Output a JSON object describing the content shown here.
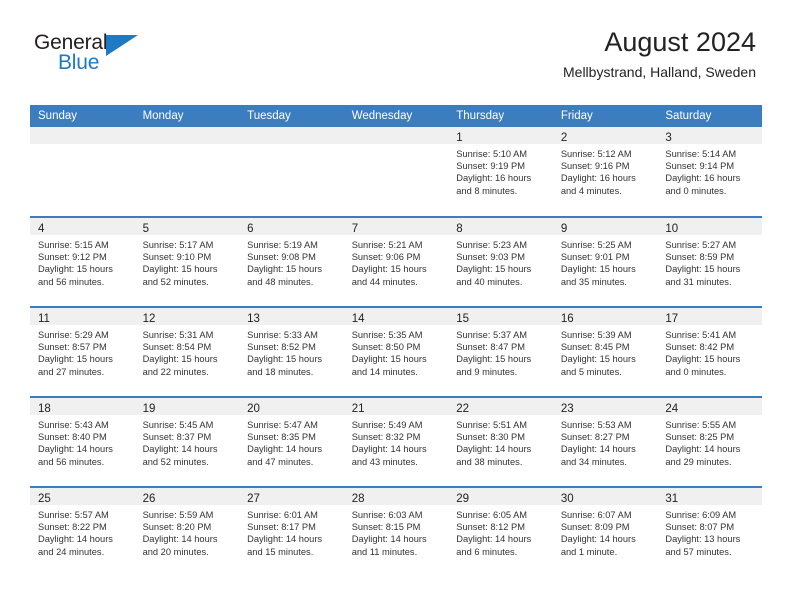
{
  "brand": {
    "name_top": "General",
    "name_bottom": "Blue"
  },
  "header": {
    "title": "August 2024",
    "subtitle": "Mellbystrand, Halland, Sweden"
  },
  "colors": {
    "header_blue": "#3b7dbf",
    "brand_blue": "#1f7ac4",
    "band_gray": "#f0f0f0"
  },
  "weekday_headers": [
    "Sunday",
    "Monday",
    "Tuesday",
    "Wednesday",
    "Thursday",
    "Friday",
    "Saturday"
  ],
  "weeks": [
    [
      {
        "day": "",
        "lines": []
      },
      {
        "day": "",
        "lines": []
      },
      {
        "day": "",
        "lines": []
      },
      {
        "day": "",
        "lines": []
      },
      {
        "day": "1",
        "lines": [
          "Sunrise: 5:10 AM",
          "Sunset: 9:19 PM",
          "Daylight: 16 hours",
          "and 8 minutes."
        ]
      },
      {
        "day": "2",
        "lines": [
          "Sunrise: 5:12 AM",
          "Sunset: 9:16 PM",
          "Daylight: 16 hours",
          "and 4 minutes."
        ]
      },
      {
        "day": "3",
        "lines": [
          "Sunrise: 5:14 AM",
          "Sunset: 9:14 PM",
          "Daylight: 16 hours",
          "and 0 minutes."
        ]
      }
    ],
    [
      {
        "day": "4",
        "lines": [
          "Sunrise: 5:15 AM",
          "Sunset: 9:12 PM",
          "Daylight: 15 hours",
          "and 56 minutes."
        ]
      },
      {
        "day": "5",
        "lines": [
          "Sunrise: 5:17 AM",
          "Sunset: 9:10 PM",
          "Daylight: 15 hours",
          "and 52 minutes."
        ]
      },
      {
        "day": "6",
        "lines": [
          "Sunrise: 5:19 AM",
          "Sunset: 9:08 PM",
          "Daylight: 15 hours",
          "and 48 minutes."
        ]
      },
      {
        "day": "7",
        "lines": [
          "Sunrise: 5:21 AM",
          "Sunset: 9:06 PM",
          "Daylight: 15 hours",
          "and 44 minutes."
        ]
      },
      {
        "day": "8",
        "lines": [
          "Sunrise: 5:23 AM",
          "Sunset: 9:03 PM",
          "Daylight: 15 hours",
          "and 40 minutes."
        ]
      },
      {
        "day": "9",
        "lines": [
          "Sunrise: 5:25 AM",
          "Sunset: 9:01 PM",
          "Daylight: 15 hours",
          "and 35 minutes."
        ]
      },
      {
        "day": "10",
        "lines": [
          "Sunrise: 5:27 AM",
          "Sunset: 8:59 PM",
          "Daylight: 15 hours",
          "and 31 minutes."
        ]
      }
    ],
    [
      {
        "day": "11",
        "lines": [
          "Sunrise: 5:29 AM",
          "Sunset: 8:57 PM",
          "Daylight: 15 hours",
          "and 27 minutes."
        ]
      },
      {
        "day": "12",
        "lines": [
          "Sunrise: 5:31 AM",
          "Sunset: 8:54 PM",
          "Daylight: 15 hours",
          "and 22 minutes."
        ]
      },
      {
        "day": "13",
        "lines": [
          "Sunrise: 5:33 AM",
          "Sunset: 8:52 PM",
          "Daylight: 15 hours",
          "and 18 minutes."
        ]
      },
      {
        "day": "14",
        "lines": [
          "Sunrise: 5:35 AM",
          "Sunset: 8:50 PM",
          "Daylight: 15 hours",
          "and 14 minutes."
        ]
      },
      {
        "day": "15",
        "lines": [
          "Sunrise: 5:37 AM",
          "Sunset: 8:47 PM",
          "Daylight: 15 hours",
          "and 9 minutes."
        ]
      },
      {
        "day": "16",
        "lines": [
          "Sunrise: 5:39 AM",
          "Sunset: 8:45 PM",
          "Daylight: 15 hours",
          "and 5 minutes."
        ]
      },
      {
        "day": "17",
        "lines": [
          "Sunrise: 5:41 AM",
          "Sunset: 8:42 PM",
          "Daylight: 15 hours",
          "and 0 minutes."
        ]
      }
    ],
    [
      {
        "day": "18",
        "lines": [
          "Sunrise: 5:43 AM",
          "Sunset: 8:40 PM",
          "Daylight: 14 hours",
          "and 56 minutes."
        ]
      },
      {
        "day": "19",
        "lines": [
          "Sunrise: 5:45 AM",
          "Sunset: 8:37 PM",
          "Daylight: 14 hours",
          "and 52 minutes."
        ]
      },
      {
        "day": "20",
        "lines": [
          "Sunrise: 5:47 AM",
          "Sunset: 8:35 PM",
          "Daylight: 14 hours",
          "and 47 minutes."
        ]
      },
      {
        "day": "21",
        "lines": [
          "Sunrise: 5:49 AM",
          "Sunset: 8:32 PM",
          "Daylight: 14 hours",
          "and 43 minutes."
        ]
      },
      {
        "day": "22",
        "lines": [
          "Sunrise: 5:51 AM",
          "Sunset: 8:30 PM",
          "Daylight: 14 hours",
          "and 38 minutes."
        ]
      },
      {
        "day": "23",
        "lines": [
          "Sunrise: 5:53 AM",
          "Sunset: 8:27 PM",
          "Daylight: 14 hours",
          "and 34 minutes."
        ]
      },
      {
        "day": "24",
        "lines": [
          "Sunrise: 5:55 AM",
          "Sunset: 8:25 PM",
          "Daylight: 14 hours",
          "and 29 minutes."
        ]
      }
    ],
    [
      {
        "day": "25",
        "lines": [
          "Sunrise: 5:57 AM",
          "Sunset: 8:22 PM",
          "Daylight: 14 hours",
          "and 24 minutes."
        ]
      },
      {
        "day": "26",
        "lines": [
          "Sunrise: 5:59 AM",
          "Sunset: 8:20 PM",
          "Daylight: 14 hours",
          "and 20 minutes."
        ]
      },
      {
        "day": "27",
        "lines": [
          "Sunrise: 6:01 AM",
          "Sunset: 8:17 PM",
          "Daylight: 14 hours",
          "and 15 minutes."
        ]
      },
      {
        "day": "28",
        "lines": [
          "Sunrise: 6:03 AM",
          "Sunset: 8:15 PM",
          "Daylight: 14 hours",
          "and 11 minutes."
        ]
      },
      {
        "day": "29",
        "lines": [
          "Sunrise: 6:05 AM",
          "Sunset: 8:12 PM",
          "Daylight: 14 hours",
          "and 6 minutes."
        ]
      },
      {
        "day": "30",
        "lines": [
          "Sunrise: 6:07 AM",
          "Sunset: 8:09 PM",
          "Daylight: 14 hours",
          "and 1 minute."
        ]
      },
      {
        "day": "31",
        "lines": [
          "Sunrise: 6:09 AM",
          "Sunset: 8:07 PM",
          "Daylight: 13 hours",
          "and 57 minutes."
        ]
      }
    ]
  ]
}
